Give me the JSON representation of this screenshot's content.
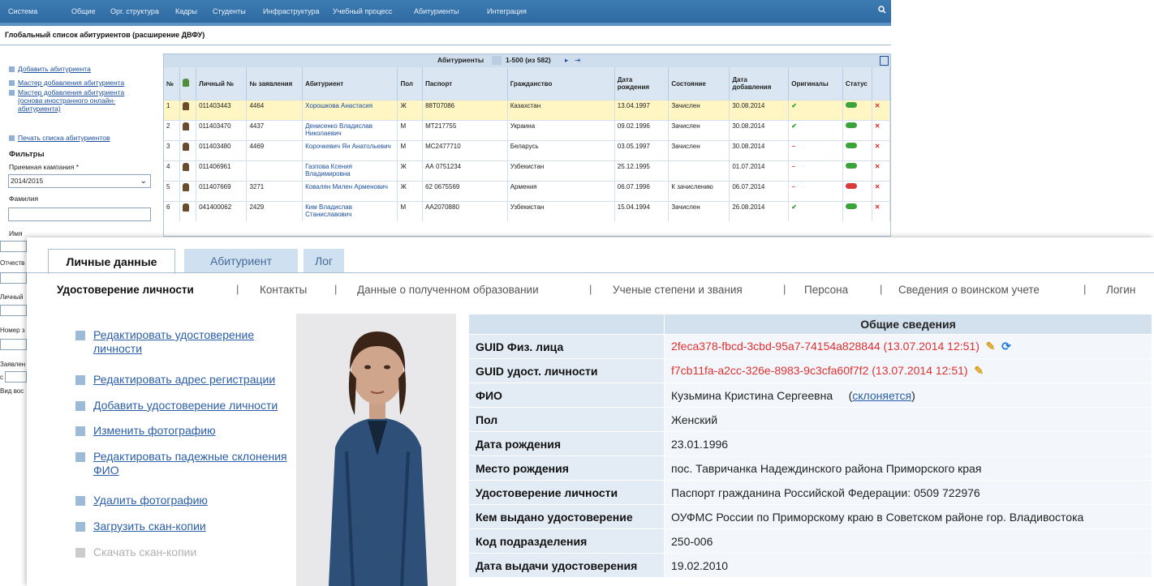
{
  "topnav": {
    "items": [
      "Система",
      "Общие",
      "Орг. структура",
      "Кадры",
      "Студенты",
      "Инфраструктура",
      "Учебный процесс",
      "Абитуриенты",
      "Интеграция"
    ]
  },
  "page_title": "Глобальный список абитуриентов (расширение ДВФУ)",
  "sidebar": {
    "links": [
      "Добавить абитуриента",
      "Мастер добавления абитуриента",
      "Мастер добавления абитуриента (основа иностранного онлайн-абитуриента)",
      "Печать списка абитуриентов"
    ],
    "filters_title": "Фильтры",
    "campaign_label": "Приемная кампания *",
    "campaign_value": "2014/2015",
    "surname_label": "Фамилия",
    "name_label": "Имя",
    "patronymic_label": "Отчеств",
    "personal_label": "Личный",
    "number_label": "Номер з",
    "application_label": "Заявлен",
    "from_label": "с",
    "added_label": "Вид вос"
  },
  "grid": {
    "caption": "Абитуриенты",
    "paging": "1-500 (из 582)",
    "columns": [
      "№",
      "",
      "Личный №",
      "№ заявления",
      "Абитуриент",
      "Пол",
      "Паспорт",
      "Гражданство",
      "Дата рождения",
      "Состояние",
      "Дата добавления",
      "Оригиналы",
      "Статус",
      ""
    ],
    "rows": [
      {
        "n": "1",
        "personal": "011403443",
        "app": "4464",
        "name": "Хорошкова Анастасия",
        "sex": "Ж",
        "passport": "88T07086",
        "citizenship": "Казахстан",
        "birth": "13.04.1997",
        "state": "Зачислен",
        "added": "30.08.2014",
        "orig": "✔",
        "status": "green"
      },
      {
        "n": "2",
        "personal": "011403470",
        "app": "4437",
        "name": "Денисенко Владислав Николаевич",
        "sex": "М",
        "passport": "МТ217755",
        "citizenship": "Украина",
        "birth": "09.02.1996",
        "state": "Зачислен",
        "added": "30.08.2014",
        "orig": "✔",
        "status": "green"
      },
      {
        "n": "3",
        "personal": "011403480",
        "app": "4469",
        "name": "Корочкевич Ян Анатольевич",
        "sex": "М",
        "passport": "МС2477710",
        "citizenship": "Беларусь",
        "birth": "03.05.1997",
        "state": "Зачислен",
        "added": "30.08.2014",
        "orig": "−",
        "status": "green"
      },
      {
        "n": "4",
        "personal": "011406961",
        "app": "",
        "name": "Газпова Ксения Владимировна",
        "sex": "Ж",
        "passport": "АА 0751234",
        "citizenship": "Узбекистан",
        "birth": "25.12.1995",
        "state": "",
        "added": "01.07.2014",
        "orig": "−",
        "status": "green"
      },
      {
        "n": "5",
        "personal": "011407669",
        "app": "3271",
        "name": "Ковалян Милен Арменович",
        "sex": "Ж",
        "passport": "62 0675569",
        "citizenship": "Армения",
        "birth": "06.07.1996",
        "state": "К зачислению",
        "added": "06.07.2014",
        "orig": "−",
        "status": "red"
      },
      {
        "n": "6",
        "personal": "041400062",
        "app": "2429",
        "name": "Ким Владислав Станиславович",
        "sex": "М",
        "passport": "АА2070880",
        "citizenship": "Узбекистан",
        "birth": "15.04.1994",
        "state": "Зачислен",
        "added": "26.08.2014",
        "orig": "✔",
        "status": "green"
      }
    ]
  },
  "tabs": [
    "Личные данные",
    "Абитуриент",
    "Лог"
  ],
  "subtabs": [
    "Удостоверение личности",
    "Контакты",
    "Данные о полученном образовании",
    "Ученые степени и звания",
    "Персона",
    "Сведения о воинском учете",
    "Логин"
  ],
  "actions": [
    "Редактировать удостоверение личности",
    "Редактировать адрес регистрации",
    "Добавить удостоверение личности",
    "Изменить фотографию",
    "Редактировать падежные склонения ФИО",
    "Удалить фотографию",
    "Загрузить скан-копии",
    "Скачать скан-копии"
  ],
  "info": {
    "header": "Общие сведения",
    "guid_person_label": "GUID Физ. лица",
    "guid_person_value": "2feca378-fbcd-3cbd-95a7-74154a828844 (13.07.2014 12:51)",
    "guid_doc_label": "GUID удост. личности",
    "guid_doc_value": "f7cb11fa-a2cc-326e-8983-9c3cfa60f7f2 (13.07.2014 12:51)",
    "fio_label": "ФИО",
    "fio_value": "Кузьмина Кристина Сергеевна",
    "declension_link": "склоняется",
    "sex_label": "Пол",
    "sex_value": "Женский",
    "birth_label": "Дата рождения",
    "birth_value": "23.01.1996",
    "birthplace_label": "Место рождения",
    "birthplace_value": "пос. Тавричанка Надеждинского района Приморского края",
    "doc_label": "Удостоверение личности",
    "doc_value": "Паспорт гражданина Российской Федерации: 0509 722976",
    "issuer_label": "Кем выдано удостоверение",
    "issuer_value": "ОУФМС России по Приморскому краю в Советском районе гор. Владивостока",
    "code_label": "Код подразделения",
    "code_value": "250-006",
    "issue_date_label": "Дата выдачи удостоверения",
    "issue_date_value": "19.02.2010"
  }
}
